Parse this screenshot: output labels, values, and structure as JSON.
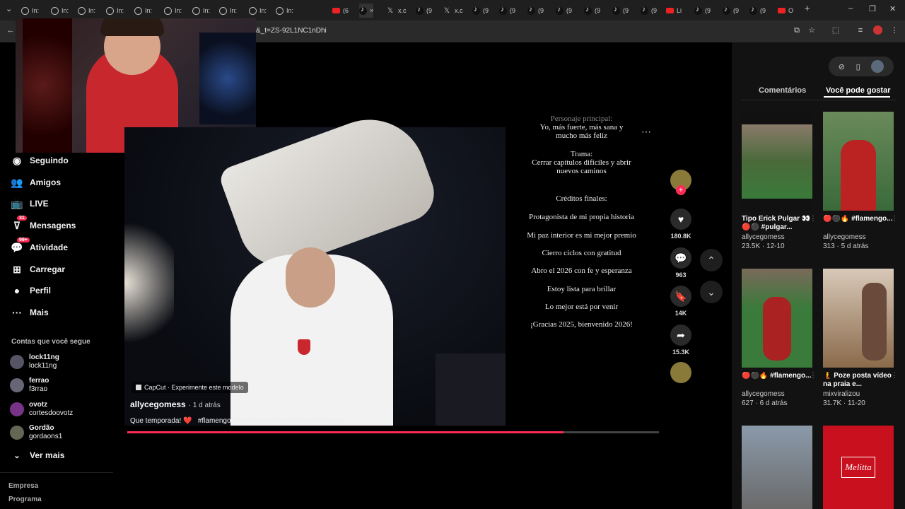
{
  "browser": {
    "tabs": [
      {
        "icon": "globe",
        "label": "In:"
      },
      {
        "icon": "globe",
        "label": "In:"
      },
      {
        "icon": "globe",
        "label": "In:"
      },
      {
        "icon": "globe",
        "label": "In:"
      },
      {
        "icon": "globe",
        "label": "In:"
      },
      {
        "icon": "globe",
        "label": "In:"
      },
      {
        "icon": "globe",
        "label": "In:"
      },
      {
        "icon": "globe",
        "label": "In:"
      },
      {
        "icon": "globe",
        "label": "In:"
      },
      {
        "icon": "globe",
        "label": "In:"
      },
      {
        "icon": "youtube",
        "label": "(6"
      },
      {
        "icon": "tiktok",
        "label": "×"
      },
      {
        "icon": "x",
        "label": "x.c"
      },
      {
        "icon": "tiktok",
        "label": "(9"
      },
      {
        "icon": "x",
        "label": "x.c"
      },
      {
        "icon": "tiktok",
        "label": "(9"
      },
      {
        "icon": "tiktok",
        "label": "(9"
      },
      {
        "icon": "tiktok",
        "label": "(9"
      },
      {
        "icon": "tiktok",
        "label": "(9"
      },
      {
        "icon": "tiktok",
        "label": "(9"
      },
      {
        "icon": "tiktok",
        "label": "(9"
      },
      {
        "icon": "tiktok",
        "label": "(9"
      },
      {
        "icon": "youtube",
        "label": "Li"
      },
      {
        "icon": "tiktok",
        "label": "(9"
      },
      {
        "icon": "tiktok",
        "label": "(9"
      },
      {
        "icon": "tiktok",
        "label": "(9"
      },
      {
        "icon": "youtube",
        "label": "O"
      }
    ],
    "new_tab": "+",
    "url": "&_t=ZS-92L1NC1nDhi",
    "win_min": "–",
    "win_max": "❐",
    "win_close": "✕"
  },
  "sidebar": {
    "nav": [
      {
        "icon": "following-icon",
        "label": "Seguindo"
      },
      {
        "icon": "friends-icon",
        "label": "Amigos"
      },
      {
        "icon": "live-icon",
        "label": "LIVE"
      },
      {
        "icon": "messages-icon",
        "label": "Mensagens",
        "badge": "31"
      },
      {
        "icon": "activity-icon",
        "label": "Atividade",
        "badge": "99+"
      },
      {
        "icon": "upload-icon",
        "label": "Carregar"
      },
      {
        "icon": "profile-icon",
        "label": "Perfil"
      },
      {
        "icon": "more-icon",
        "label": "Mais"
      }
    ],
    "following_title": "Contas que você segue",
    "following": [
      {
        "name": "lock11ng",
        "handle": "lock11ng"
      },
      {
        "name": "ferrao",
        "handle": "f3rrao"
      },
      {
        "name": "ovotz",
        "handle": "cortesdoovotz"
      },
      {
        "name": "Gordão",
        "handle": "gordaons1"
      }
    ],
    "see_more": "Ver mais",
    "footer": [
      "Empresa",
      "Programa"
    ]
  },
  "video": {
    "capcut": "CapCut · Experimente este modelo",
    "author": "allycegomess",
    "time": "· 1 d atrás",
    "caption": "Que temporada! ❤️   #flamengo #flamengosempre #naçãorubronegra",
    "progress": 0.82
  },
  "lyrics": [
    "Personaje principal:",
    "Yo, más fuerte, más sana y",
    "mucho más feliz",
    "Trama:",
    "Cerrar capítulos difíciles y abrir",
    "nuevos caminos",
    "Créditos finales:",
    "Protagonista de mi propia historia",
    "Mi paz interior es mi mejor premio",
    "Cierro ciclos con gratitud",
    "Abro el 2026 con fe y esperanza",
    "Estoy lista para brillar",
    "Lo mejor está por venir",
    "¡Gracias 2025, bienvenido 2026!"
  ],
  "actions": {
    "likes": "180.8K",
    "comments": "963",
    "saves": "14K",
    "shares": "15.3K"
  },
  "panel": {
    "tab_comments": "Comentários",
    "tab_suggested": "Você pode gostar",
    "cards": [
      {
        "title": "Tipo Erick Pulgar 👀🔴⚫ #pulgar...",
        "author": "allycegomess",
        "meta": "23.5K · 12-10"
      },
      {
        "title": "🔴⚫🔥 #flamengo...",
        "author": "allycegomess",
        "meta": "313 · 5 d atrás"
      },
      {
        "title": "🔴⚫🔥 #flamengo...",
        "author": "allycegomess",
        "meta": "627 · 6 d atrás"
      },
      {
        "title": "🧜 Poze posta vídeo na praia e...",
        "author": "mixviralizou",
        "meta": "31.7K · 11-20"
      }
    ],
    "melitta": "Melitta"
  },
  "colors": {
    "accent": "#fe2c55",
    "gold": "#e6c06a"
  }
}
